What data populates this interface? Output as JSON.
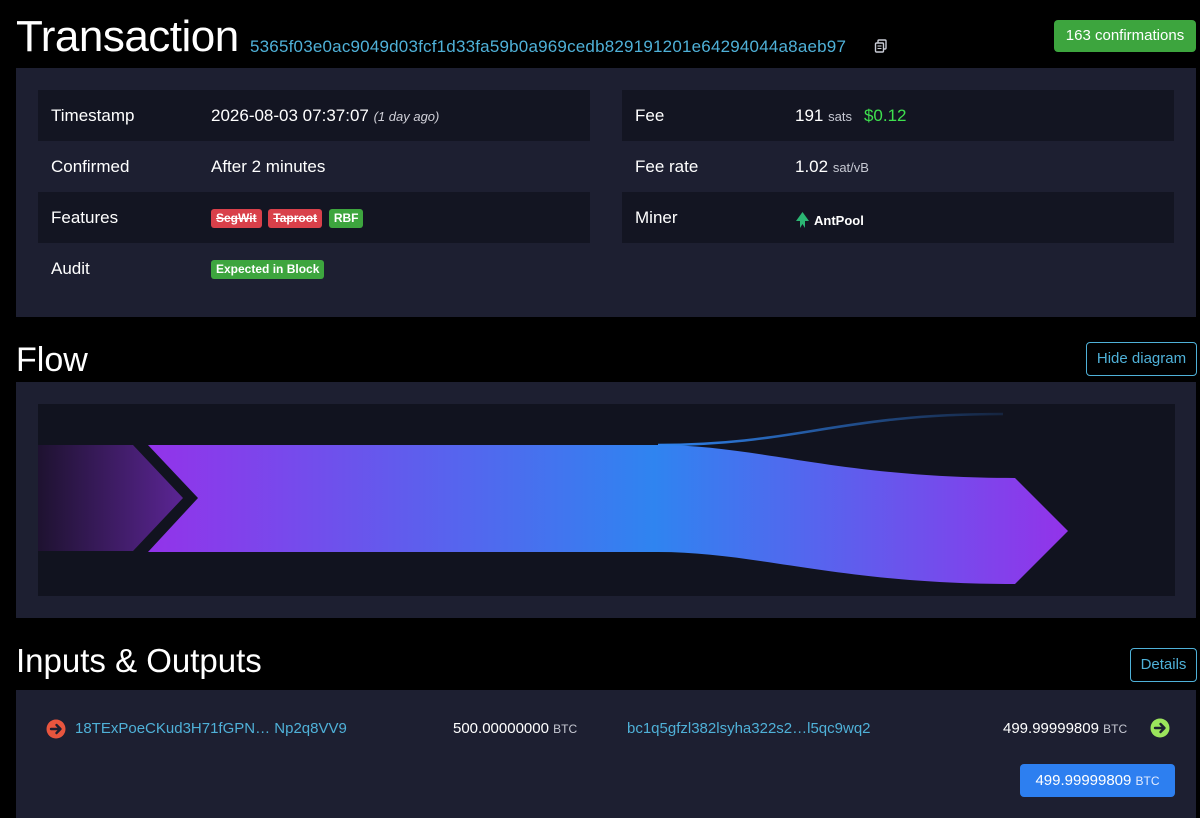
{
  "header": {
    "title": "Transaction",
    "txid": "5365f03e0ac9049d03fcf1d33fa59b0a969cedb829191201e64294044a8aeb97",
    "confirmations": "163 confirmations"
  },
  "details": {
    "left": [
      {
        "label": "Timestamp",
        "value": "2026-08-03 07:37:07",
        "note": "(1 day ago)"
      },
      {
        "label": "Confirmed",
        "value": "After 2 minutes"
      },
      {
        "label": "Features",
        "tags": [
          {
            "text": "SegWit",
            "state": "disabled"
          },
          {
            "text": "Taproot",
            "state": "disabled"
          },
          {
            "text": "RBF",
            "state": "enabled"
          }
        ]
      },
      {
        "label": "Audit",
        "badge": "Expected in Block"
      }
    ],
    "right": [
      {
        "label": "Fee",
        "value": "191",
        "unit": "sats",
        "usd": "$0.12"
      },
      {
        "label": "Fee rate",
        "value": "1.02",
        "unit": "sat/vB"
      },
      {
        "label": "Miner",
        "value": "AntPool"
      }
    ]
  },
  "flow": {
    "title": "Flow",
    "toggle_label": "Hide diagram",
    "colors": {
      "start": "#9333ea",
      "mid": "#2f84f0",
      "end": "#9333ea",
      "fade": "#1e1230"
    }
  },
  "io": {
    "title": "Inputs & Outputs",
    "details_label": "Details",
    "input": {
      "address": "18TExPoeCKud3H71fGPN… Np2q8VV9",
      "amount": "500.00000000",
      "unit": "BTC"
    },
    "output": {
      "address": "bc1q5gfzl382lsyha322s2…l5qc9wq2",
      "amount": "499.99999809",
      "unit": "BTC"
    },
    "total": {
      "amount": "499.99999809",
      "unit": "BTC"
    }
  },
  "icons": {
    "copy": "copy-icon",
    "input_arrow": "arrow-right-circle-red-icon",
    "output_arrow": "arrow-right-circle-green-icon",
    "miner_logo": "antpool-logo-icon"
  },
  "accent_colors": {
    "link": "#4fb1d8",
    "success": "#3da53e",
    "danger": "#d9404a",
    "primary": "#2d7ff0"
  }
}
